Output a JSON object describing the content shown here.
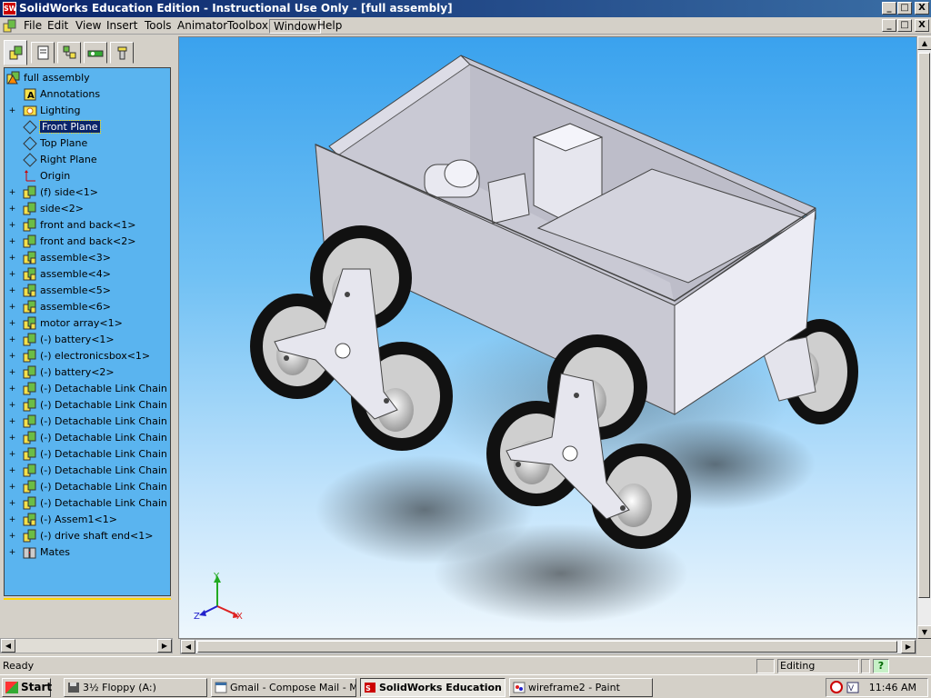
{
  "window": {
    "title": "SolidWorks Education Edition - Instructional Use Only - [full assembly]",
    "app_icon": "solidworks-icon",
    "buttons": [
      "_",
      "□",
      "X"
    ]
  },
  "menubar": {
    "doc_buttons": [
      "_",
      "□",
      "X"
    ],
    "items": [
      "File",
      "Edit",
      "View",
      "Insert",
      "Tools",
      "Animator",
      "Toolbox",
      "Window",
      "Help"
    ],
    "active": "Window"
  },
  "feature_manager": {
    "tabs": [
      "featuremanager-tab",
      "propertymanager-tab",
      "configurationmanager-tab",
      "dimxpert-tab",
      "toolbox-tab"
    ],
    "tree": [
      {
        "label": "full assembly",
        "icon": "assembly-warning-icon",
        "expander": "",
        "level": 0
      },
      {
        "label": "Annotations",
        "icon": "annotations-icon",
        "expander": "",
        "level": 1
      },
      {
        "label": "Lighting",
        "icon": "lighting-icon",
        "expander": "+",
        "level": 1
      },
      {
        "label": "Front Plane",
        "icon": "plane-icon",
        "expander": "",
        "level": 1,
        "selected": true
      },
      {
        "label": "Top Plane",
        "icon": "plane-icon",
        "expander": "",
        "level": 1
      },
      {
        "label": "Right Plane",
        "icon": "plane-icon",
        "expander": "",
        "level": 1
      },
      {
        "label": "Origin",
        "icon": "origin-icon",
        "expander": "",
        "level": 1
      },
      {
        "label": "(f) side<1>",
        "icon": "part-icon",
        "expander": "+",
        "level": 1
      },
      {
        "label": "side<2>",
        "icon": "part-icon",
        "expander": "+",
        "level": 1
      },
      {
        "label": "front and back<1>",
        "icon": "part-icon",
        "expander": "+",
        "level": 1
      },
      {
        "label": "front and back<2>",
        "icon": "part-icon",
        "expander": "+",
        "level": 1
      },
      {
        "label": "assemble<3>",
        "icon": "subassembly-icon",
        "expander": "+",
        "level": 1
      },
      {
        "label": "assemble<4>",
        "icon": "subassembly-icon",
        "expander": "+",
        "level": 1
      },
      {
        "label": "assemble<5>",
        "icon": "subassembly-icon",
        "expander": "+",
        "level": 1
      },
      {
        "label": "assemble<6>",
        "icon": "subassembly-icon",
        "expander": "+",
        "level": 1
      },
      {
        "label": "motor array<1>",
        "icon": "subassembly-icon",
        "expander": "+",
        "level": 1
      },
      {
        "label": "(-) battery<1>",
        "icon": "part-icon",
        "expander": "+",
        "level": 1
      },
      {
        "label": "(-) electronicsbox<1>",
        "icon": "part-icon",
        "expander": "+",
        "level": 1
      },
      {
        "label": "(-) battery<2>",
        "icon": "part-icon",
        "expander": "+",
        "level": 1
      },
      {
        "label": "(-) Detachable Link Chain Sprc",
        "icon": "part-icon",
        "expander": "+",
        "level": 1
      },
      {
        "label": "(-) Detachable Link Chain Sprc",
        "icon": "part-icon",
        "expander": "+",
        "level": 1
      },
      {
        "label": "(-) Detachable Link Chain Sprc",
        "icon": "part-icon",
        "expander": "+",
        "level": 1
      },
      {
        "label": "(-) Detachable Link Chain Sprc",
        "icon": "part-icon",
        "expander": "+",
        "level": 1
      },
      {
        "label": "(-) Detachable Link Chain Sprc",
        "icon": "part-icon",
        "expander": "+",
        "level": 1
      },
      {
        "label": "(-) Detachable Link Chain Sprc",
        "icon": "part-icon",
        "expander": "+",
        "level": 1
      },
      {
        "label": "(-) Detachable Link Chain Sprc",
        "icon": "part-icon",
        "expander": "+",
        "level": 1
      },
      {
        "label": "(-) Detachable Link Chain Sprc",
        "icon": "part-icon",
        "expander": "+",
        "level": 1
      },
      {
        "label": "(-) Assem1<1>",
        "icon": "subassembly-icon",
        "expander": "+",
        "level": 1
      },
      {
        "label": "(-) drive shaft end<1>",
        "icon": "part-icon",
        "expander": "+",
        "level": 1
      },
      {
        "label": "Mates",
        "icon": "mates-icon",
        "expander": "+",
        "level": 1
      }
    ]
  },
  "viewport": {
    "triad_labels": {
      "x": "X",
      "y": "Y",
      "z": "Z"
    }
  },
  "statusbar": {
    "left": "Ready",
    "mode": "Editing Assembly",
    "help": "?"
  },
  "taskbar": {
    "start": "Start",
    "buttons": [
      {
        "label": "3½ Floppy (A:)",
        "icon": "floppy-icon",
        "active": false
      },
      {
        "label": "Gmail - Compose Mail - Mi...",
        "icon": "browser-icon",
        "active": false
      },
      {
        "label": "SolidWorks Education ...",
        "icon": "solidworks-icon",
        "active": true
      },
      {
        "label": "wireframe2 - Paint",
        "icon": "paint-icon",
        "active": false
      }
    ],
    "clock": "11:46 AM"
  },
  "colors": {
    "title_bar": "#0a246a",
    "tree_background": "#5ab4ef",
    "selection": "#0a246a",
    "viewport_top": "#3aa2ee"
  }
}
